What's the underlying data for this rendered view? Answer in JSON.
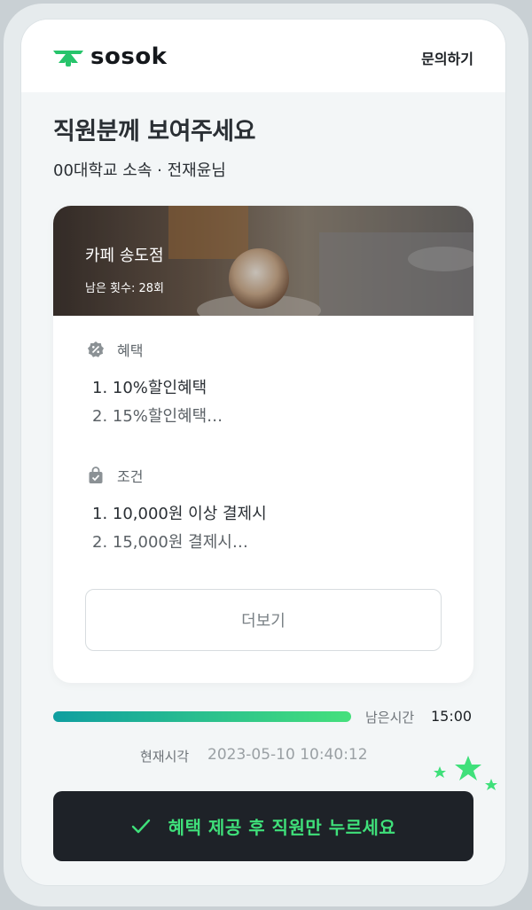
{
  "header": {
    "brand": "sosok",
    "inquiry_label": "문의하기"
  },
  "page": {
    "title": "직원분께 보여주세요",
    "subtitle": "00대학교 소속 · 전재윤님"
  },
  "store": {
    "name": "카페 송도점",
    "remaining": "남은 횟수: 28회"
  },
  "benefits": {
    "label": "혜택",
    "items": [
      "1. 10%할인혜택",
      "2. 15%할인혜택…"
    ]
  },
  "conditions": {
    "label": "조건",
    "items": [
      "1. 10,000원 이상 결제시",
      "2. 15,000원 결제시…"
    ]
  },
  "more_button": "더보기",
  "timer": {
    "label": "남은시간",
    "value": "15:00",
    "progress": 1.0
  },
  "current_time": {
    "label": "현재시각",
    "value": "2023-05-10 10:40:12"
  },
  "cta": {
    "label": "혜택 제공 후 직원만 누르세요"
  },
  "colors": {
    "accent_green": "#3fe07a",
    "teal": "#0f9ea0",
    "dark": "#1e2228"
  },
  "icons": {
    "logo": "sprout-logo-icon",
    "benefit": "percent-badge-icon",
    "condition": "shopping-bag-check-icon",
    "cta": "checkmark-icon",
    "decoration": "stars-icon"
  }
}
